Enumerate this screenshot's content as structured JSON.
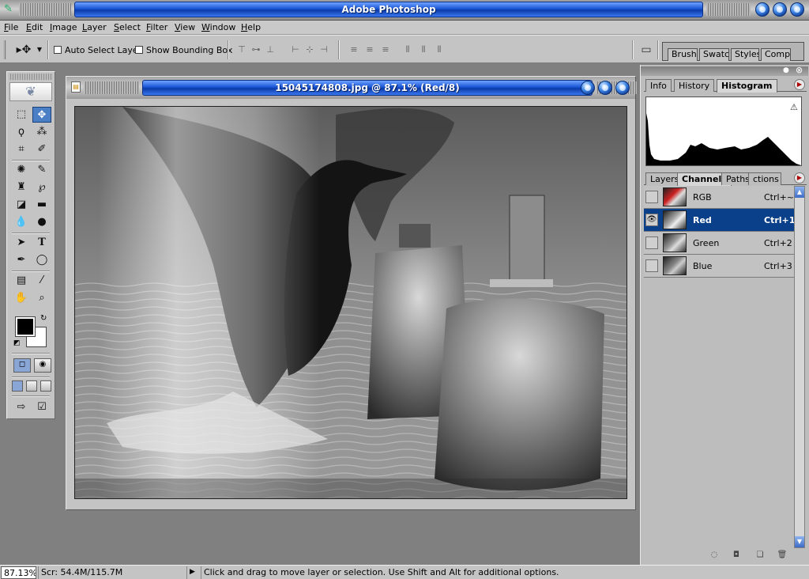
{
  "app": {
    "title": "Adobe Photoshop"
  },
  "menu": [
    "File",
    "Edit",
    "Image",
    "Layer",
    "Select",
    "Filter",
    "View",
    "Window",
    "Help"
  ],
  "options": {
    "auto_select_label": "Auto Select Layer",
    "auto_select_checked": false,
    "bounding_box_label": "Show Bounding Box",
    "bounding_box_checked": false
  },
  "palette_well": [
    "Brushes",
    "Swatch",
    "Styles",
    "Comps"
  ],
  "document": {
    "title": "15045174808.jpg @ 87.1% (Red/8)"
  },
  "top_palette": {
    "tabs": [
      "Info",
      "History",
      "Histogram"
    ],
    "active_tab": "Histogram"
  },
  "channels_palette": {
    "tabs": [
      "Layers",
      "Channels",
      "Paths",
      "ctions"
    ],
    "active_tab": "Channels",
    "channels": [
      {
        "name": "RGB",
        "shortcut": "Ctrl+~",
        "visible": false,
        "selected": false
      },
      {
        "name": "Red",
        "shortcut": "Ctrl+1",
        "visible": true,
        "selected": true
      },
      {
        "name": "Green",
        "shortcut": "Ctrl+2",
        "visible": false,
        "selected": false
      },
      {
        "name": "Blue",
        "shortcut": "Ctrl+3",
        "visible": false,
        "selected": false
      }
    ]
  },
  "status": {
    "zoom": "87.13%",
    "scratch": "Scr: 54.4M/115.7M",
    "hint": "Click and drag to move layer or selection.  Use Shift and Alt for additional options."
  },
  "colors": {
    "foreground": "#000000",
    "background": "#ffffff",
    "selection": "#0a3f8a"
  }
}
